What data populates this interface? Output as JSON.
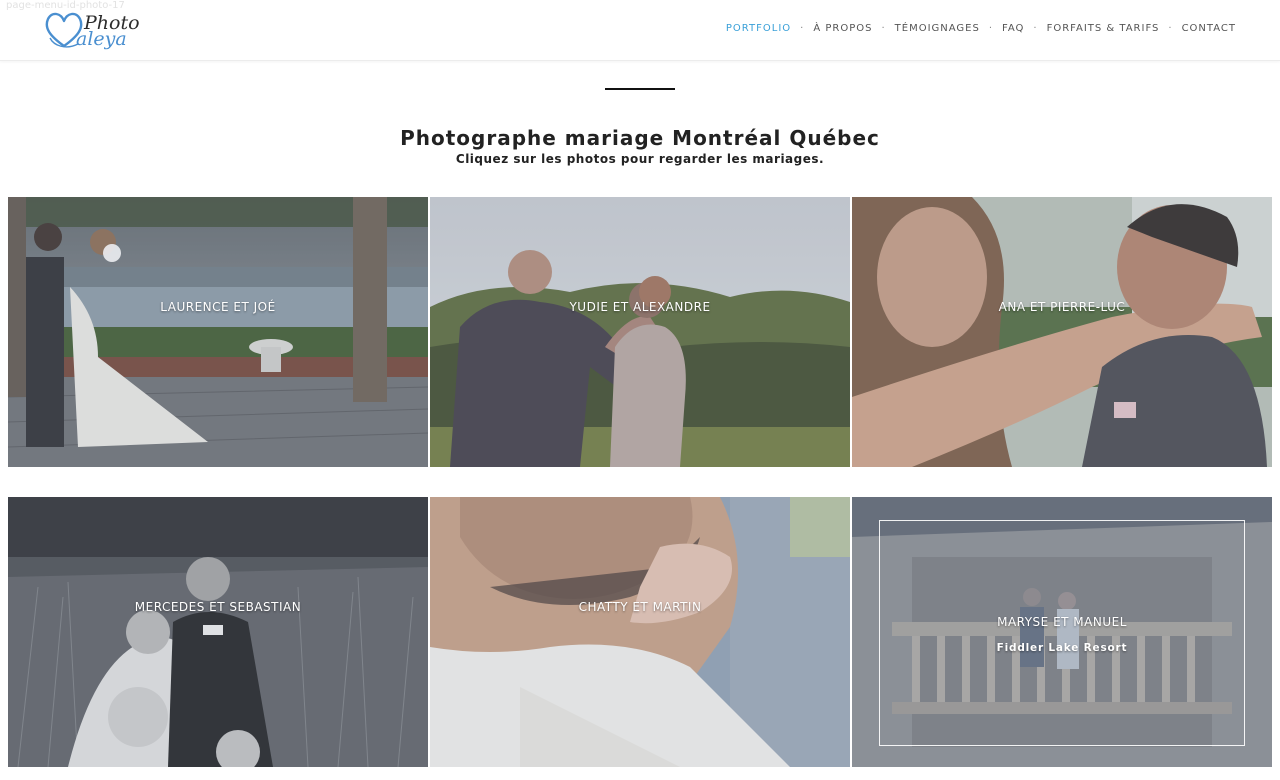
{
  "page_label": "page-menu-id-photo-17",
  "logo": {
    "line1": "Photo",
    "line2": "aleya",
    "accent_color": "#4a8fd0"
  },
  "nav": {
    "items": [
      {
        "label": "PORTFOLIO",
        "active": true
      },
      {
        "label": "À PROPOS"
      },
      {
        "label": "TÉMOIGNAGES"
      },
      {
        "label": "FAQ"
      },
      {
        "label": "FORFAITS & TARIFS"
      },
      {
        "label": "CONTACT"
      }
    ],
    "separator": "·",
    "active_color": "#3aa0d8"
  },
  "heading": {
    "title": "Photographe mariage Montréal Québec",
    "subtitle": "Cliquez sur les photos pour regarder les mariages."
  },
  "gallery": {
    "items": [
      {
        "caption": "LAURENCE ET JOÉ"
      },
      {
        "caption": "YUDIE ET ALEXANDRE"
      },
      {
        "caption": "ANA ET PIERRE-LUC"
      },
      {
        "caption": "MERCEDES ET SEBASTIAN"
      },
      {
        "caption": "CHATTY ET MARTIN"
      },
      {
        "caption": "MARYSE ET MANUEL",
        "subcaption": "Fiddler Lake Resort",
        "hovered": true
      }
    ]
  }
}
